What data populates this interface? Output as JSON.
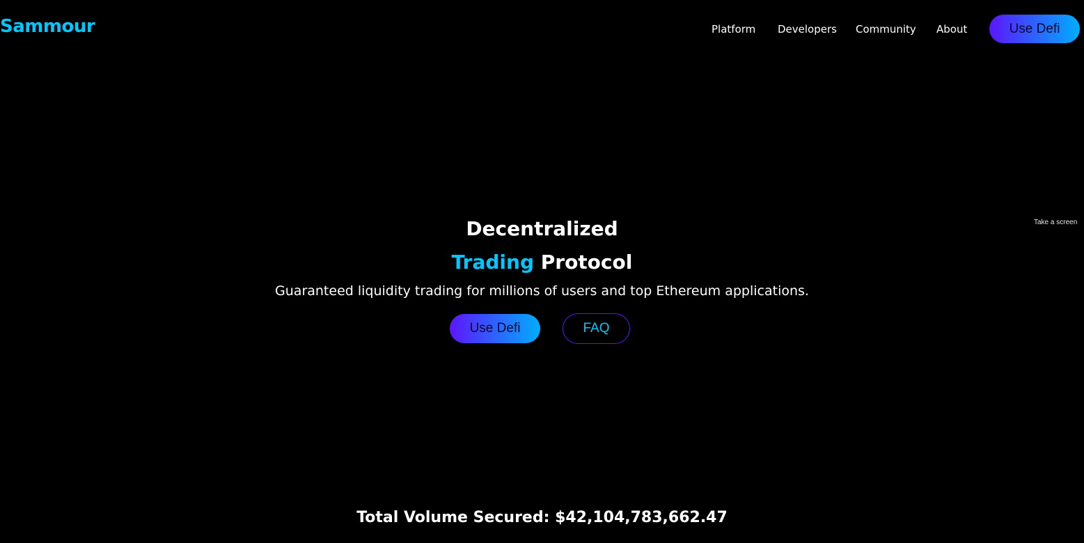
{
  "brand": {
    "name": "Sammour"
  },
  "nav": {
    "links": [
      "Platform",
      "Developers",
      "Community",
      "About"
    ],
    "cta_label": "Use Defi"
  },
  "side_note": "Take a screen",
  "hero": {
    "line1": "Decentralized",
    "line2_accent": "Trading",
    "line2_rest": "Protocol",
    "subtitle": "Guaranteed liquidity trading for millions of users and top Ethereum applications.",
    "primary_button": "Use Defi",
    "secondary_button": "FAQ"
  },
  "stats": {
    "volume_label": "Total Volume Secured:",
    "volume_value": "$42,104,783,662.47"
  },
  "colors": {
    "background": "#000000",
    "accent": "#00c8ff",
    "gradient_start": "#5b16ff",
    "gradient_end": "#00aeff",
    "text": "#ffffff"
  }
}
